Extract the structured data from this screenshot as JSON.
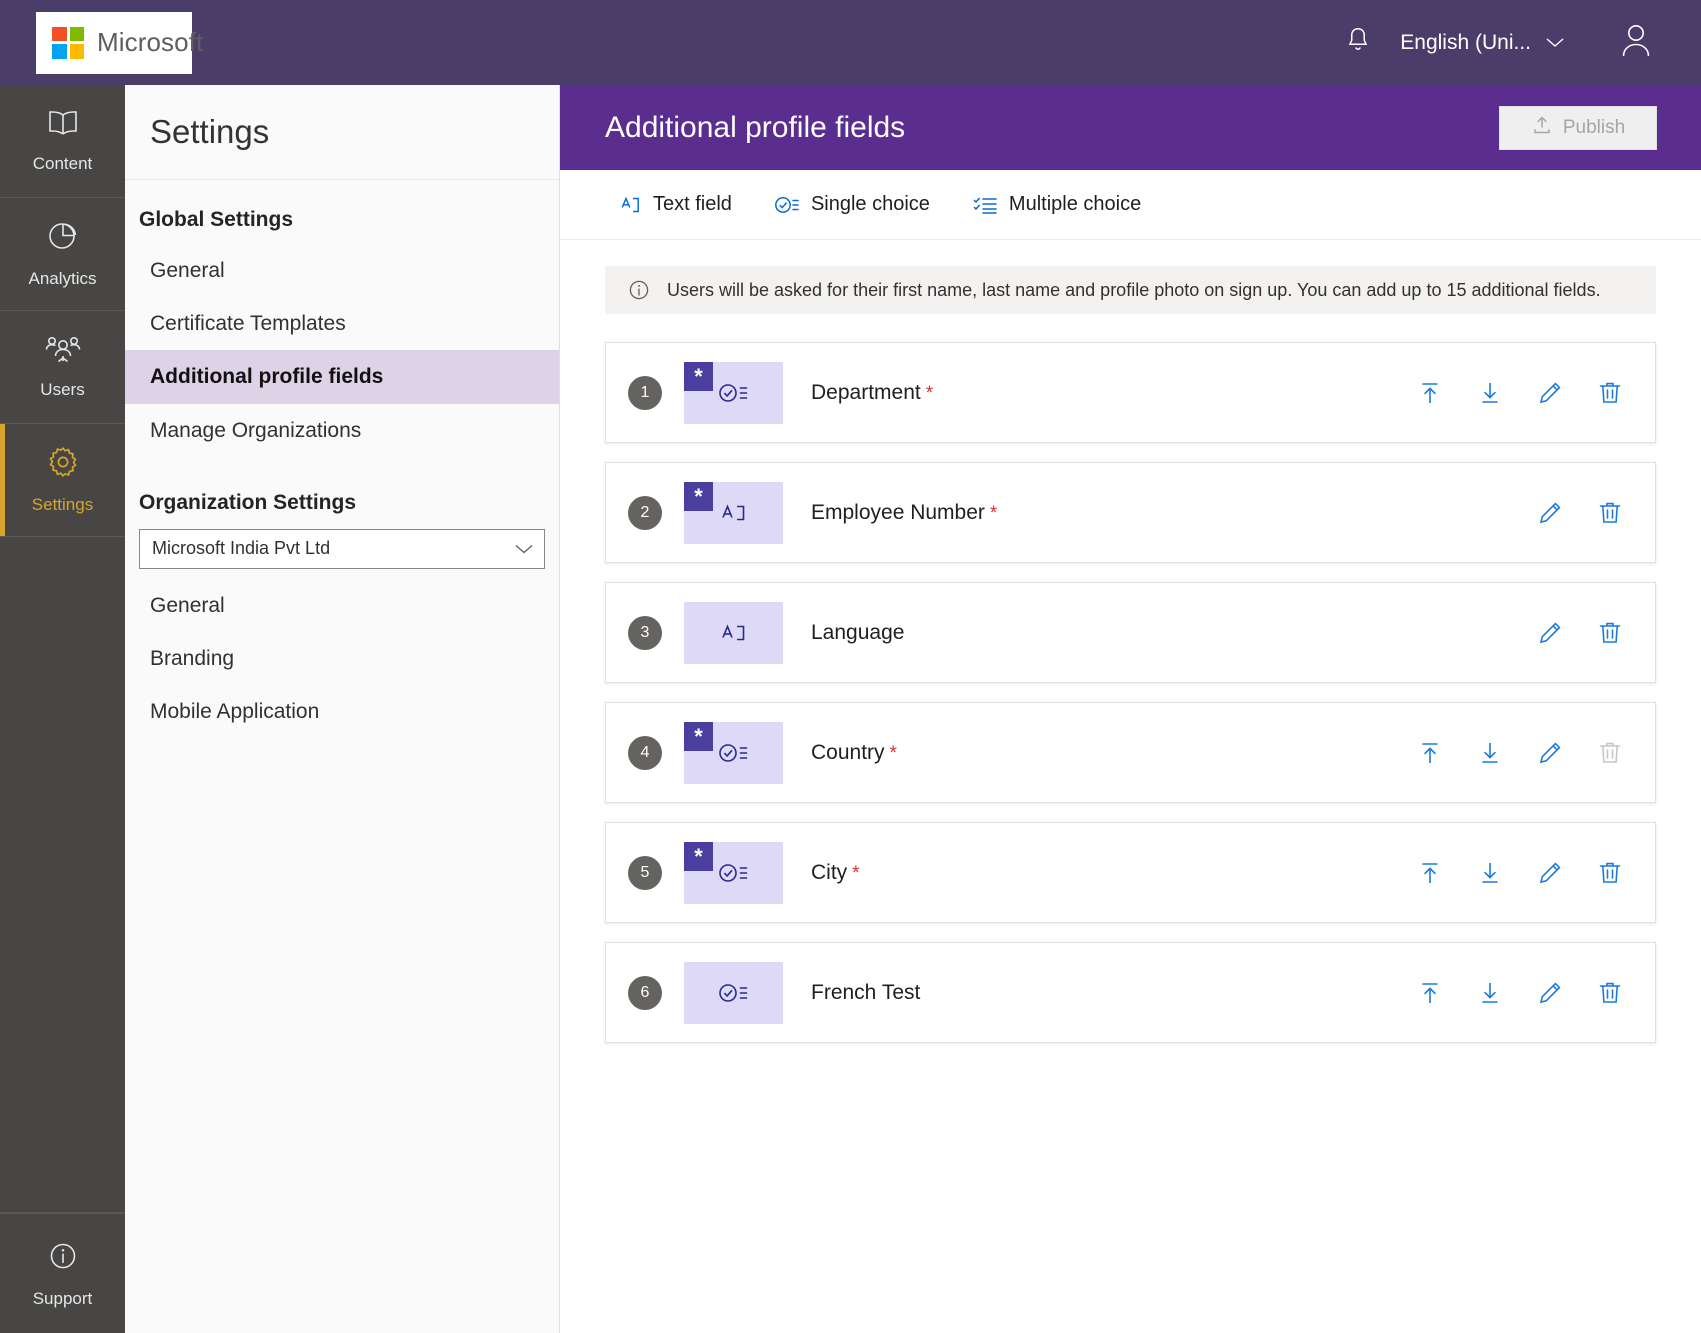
{
  "header": {
    "brand": "Microsoft",
    "bell_icon": "bell-icon",
    "language": "English (Uni...",
    "chevron_icon": "chevron-down-icon",
    "account_icon": "person-icon"
  },
  "rail": {
    "items": [
      {
        "label": "Content",
        "icon": "book-icon",
        "active": false
      },
      {
        "label": "Analytics",
        "icon": "pie-chart-icon",
        "active": false
      },
      {
        "label": "Users",
        "icon": "people-icon",
        "active": false
      },
      {
        "label": "Settings",
        "icon": "gear-icon",
        "active": true
      }
    ],
    "support": {
      "label": "Support",
      "icon": "info-circle-icon"
    }
  },
  "settings_panel": {
    "title": "Settings",
    "global_heading": "Global Settings",
    "global_items": [
      {
        "label": "General",
        "selected": false
      },
      {
        "label": "Certificate Templates",
        "selected": false
      },
      {
        "label": "Additional profile fields",
        "selected": true
      },
      {
        "label": "Manage Organizations",
        "selected": false
      }
    ],
    "org_heading": "Organization Settings",
    "org_selected": "Microsoft India Pvt Ltd",
    "org_items": [
      {
        "label": "General"
      },
      {
        "label": "Branding"
      },
      {
        "label": "Mobile Application"
      }
    ]
  },
  "main": {
    "title": "Additional profile fields",
    "publish_label": "Publish",
    "publish_icon": "upload-icon",
    "publish_disabled": true,
    "toolbar": [
      {
        "label": "Text field",
        "icon": "text-field-icon"
      },
      {
        "label": "Single choice",
        "icon": "single-choice-icon"
      },
      {
        "label": "Multiple choice",
        "icon": "multiple-choice-icon"
      }
    ],
    "info_icon": "info-circle-icon",
    "info_text": "Users will be asked for their first name, last name and profile photo on sign up. You can add up to 15 additional fields.",
    "required_marker": "*",
    "fields": [
      {
        "number": "1",
        "label": "Department",
        "required": true,
        "type_icon": "single-choice-icon",
        "required_badge": "*",
        "actions": {
          "move_top": true,
          "move_bottom": true,
          "edit": true,
          "delete": true,
          "delete_disabled": false
        }
      },
      {
        "number": "2",
        "label": "Employee Number",
        "required": true,
        "type_icon": "text-field-icon",
        "required_badge": "*",
        "actions": {
          "move_top": false,
          "move_bottom": false,
          "edit": true,
          "delete": true,
          "delete_disabled": false
        }
      },
      {
        "number": "3",
        "label": "Language",
        "required": false,
        "type_icon": "text-field-icon",
        "required_badge": "",
        "actions": {
          "move_top": false,
          "move_bottom": false,
          "edit": true,
          "delete": true,
          "delete_disabled": false
        }
      },
      {
        "number": "4",
        "label": "Country",
        "required": true,
        "type_icon": "single-choice-icon",
        "required_badge": "*",
        "actions": {
          "move_top": true,
          "move_bottom": true,
          "edit": true,
          "delete": true,
          "delete_disabled": true
        }
      },
      {
        "number": "5",
        "label": "City",
        "required": true,
        "type_icon": "single-choice-icon",
        "required_badge": "*",
        "actions": {
          "move_top": true,
          "move_bottom": true,
          "edit": true,
          "delete": true,
          "delete_disabled": false
        }
      },
      {
        "number": "6",
        "label": "French Test",
        "required": false,
        "type_icon": "single-choice-icon",
        "required_badge": "",
        "actions": {
          "move_top": true,
          "move_bottom": true,
          "edit": true,
          "delete": true,
          "delete_disabled": false
        }
      }
    ]
  },
  "colors": {
    "topbar": "#4b3d69",
    "main_header": "#5b2d8e",
    "rail": "#484644",
    "accent_gold": "#d9a42b",
    "selected_nav": "#ded2e6",
    "action_blue": "#1a7ae0",
    "required_red": "#d13438",
    "type_box": "#ddd9f7",
    "badge_purple": "#4a3f9e"
  }
}
